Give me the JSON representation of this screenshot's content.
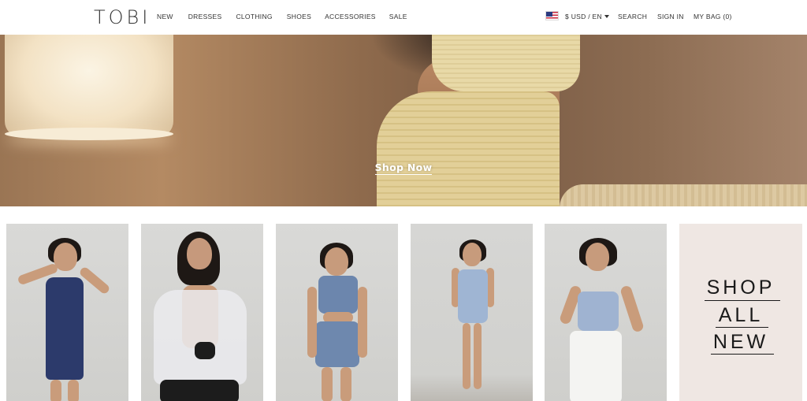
{
  "brand": {
    "logo": "TOBI"
  },
  "nav": {
    "items": [
      "NEW",
      "DRESSES",
      "CLOTHING",
      "SHOES",
      "ACCESSORIES",
      "SALE"
    ]
  },
  "utility": {
    "locale": "$ USD / EN",
    "search": "SEARCH",
    "sign_in": "SIGN IN",
    "bag": "MY BAG (0)"
  },
  "hero": {
    "cta": "Shop Now"
  },
  "promo_tile": {
    "lines": [
      "SHOP",
      "ALL",
      "NEW"
    ]
  },
  "colors": {
    "background": "#ffffff",
    "text": "#333333",
    "promo_bg": "#efe7e3",
    "hero_cta": "#ffffff"
  },
  "icons": {
    "flag": "us-flag-icon",
    "locale_caret": "caret-down-icon"
  }
}
